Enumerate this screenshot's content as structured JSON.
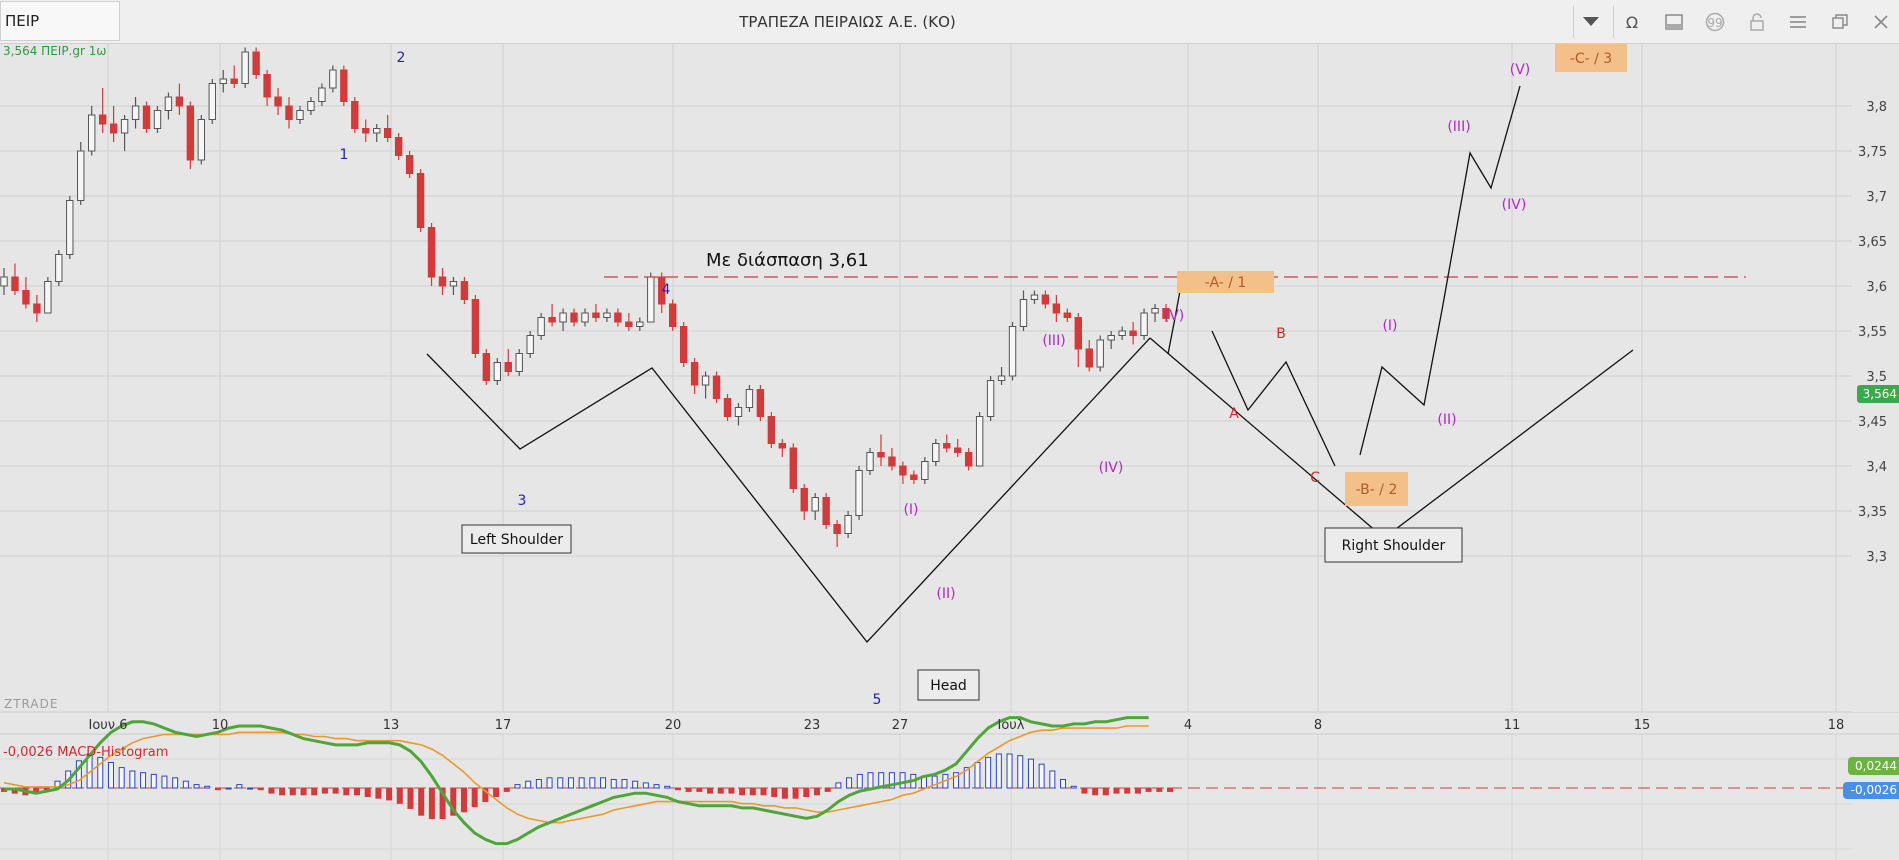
{
  "toolbar": {
    "symbol": "ΠΕΙΡ",
    "title": "ΤΡΑΠΕΖΑ ΠΕΙΡΑΙΩΣ Α.Ε. (ΚΟ)",
    "icons": [
      "chevron-down-icon",
      "omega-icon",
      "panel-icon",
      "quote-icon",
      "lock-icon",
      "menu-icon",
      "restore-icon",
      "close-icon"
    ]
  },
  "chart_label": "3,564 ΠΕΙΡ.gr 1ω",
  "watermark": "ZTRADE",
  "macd_label": "-0,0026 MACD-Histogram",
  "current_price_tag": "3,564",
  "macd_tag1": "0,0244",
  "macd_tag2": "-0,0026",
  "colors": {
    "up": "#f6f6f6",
    "down": "#d13b3b",
    "wave_blue": "#2323b5",
    "wave_purple": "#b02ac2",
    "wave_red": "#d12b2b",
    "box_orange": "#f4c08a",
    "macd_line": "#4fa53a",
    "signal_line": "#e89a2c"
  },
  "chart_data": {
    "type": "candlestick",
    "ylim": [
      3.27,
      3.86
    ],
    "yticks": [
      "3,3",
      "3,35",
      "3,4",
      "3,45",
      "3,5",
      "3,55",
      "3,6",
      "3,65",
      "3,7",
      "3,75",
      "3,8"
    ],
    "xticks": [
      "Ιουν 6",
      "10",
      "13",
      "17",
      "20",
      "23",
      "27",
      "Ιουλ",
      "4",
      "8",
      "11",
      "15",
      "18"
    ],
    "breakout_level": 3.61,
    "breakout_text": "Με διάσπαση 3,61",
    "candles": [
      [
        3.6,
        3.62,
        3.59,
        3.61
      ],
      [
        3.61,
        3.625,
        3.59,
        3.595
      ],
      [
        3.595,
        3.61,
        3.575,
        3.58
      ],
      [
        3.58,
        3.59,
        3.56,
        3.57
      ],
      [
        3.57,
        3.61,
        3.57,
        3.605
      ],
      [
        3.605,
        3.64,
        3.6,
        3.635
      ],
      [
        3.635,
        3.7,
        3.63,
        3.695
      ],
      [
        3.695,
        3.76,
        3.69,
        3.75
      ],
      [
        3.75,
        3.8,
        3.745,
        3.79
      ],
      [
        3.79,
        3.82,
        3.77,
        3.78
      ],
      [
        3.78,
        3.8,
        3.76,
        3.77
      ],
      [
        3.77,
        3.79,
        3.75,
        3.785
      ],
      [
        3.785,
        3.81,
        3.775,
        3.8
      ],
      [
        3.8,
        3.805,
        3.77,
        3.775
      ],
      [
        3.775,
        3.8,
        3.77,
        3.795
      ],
      [
        3.795,
        3.815,
        3.785,
        3.81
      ],
      [
        3.81,
        3.825,
        3.79,
        3.8
      ],
      [
        3.8,
        3.805,
        3.73,
        3.74
      ],
      [
        3.74,
        3.79,
        3.735,
        3.785
      ],
      [
        3.785,
        3.83,
        3.78,
        3.825
      ],
      [
        3.825,
        3.84,
        3.815,
        3.83
      ],
      [
        3.83,
        3.845,
        3.82,
        3.825
      ],
      [
        3.825,
        3.865,
        3.82,
        3.86
      ],
      [
        3.86,
        3.865,
        3.83,
        3.835
      ],
      [
        3.835,
        3.84,
        3.8,
        3.81
      ],
      [
        3.81,
        3.82,
        3.79,
        3.8
      ],
      [
        3.8,
        3.81,
        3.775,
        3.785
      ],
      [
        3.785,
        3.8,
        3.78,
        3.795
      ],
      [
        3.795,
        3.81,
        3.79,
        3.805
      ],
      [
        3.805,
        3.825,
        3.8,
        3.82
      ],
      [
        3.82,
        3.845,
        3.815,
        3.84
      ],
      [
        3.84,
        3.845,
        3.8,
        3.805
      ],
      [
        3.805,
        3.81,
        3.77,
        3.775
      ],
      [
        3.775,
        3.785,
        3.76,
        3.77
      ],
      [
        3.77,
        3.78,
        3.76,
        3.775
      ],
      [
        3.775,
        3.79,
        3.76,
        3.765
      ],
      [
        3.765,
        3.77,
        3.74,
        3.745
      ],
      [
        3.745,
        3.75,
        3.72,
        3.725
      ],
      [
        3.725,
        3.73,
        3.66,
        3.665
      ],
      [
        3.665,
        3.67,
        3.6,
        3.61
      ],
      [
        3.61,
        3.62,
        3.59,
        3.6
      ],
      [
        3.6,
        3.61,
        3.59,
        3.605
      ],
      [
        3.605,
        3.61,
        3.58,
        3.585
      ],
      [
        3.585,
        3.59,
        3.52,
        3.525
      ],
      [
        3.525,
        3.53,
        3.49,
        3.495
      ],
      [
        3.495,
        3.52,
        3.49,
        3.515
      ],
      [
        3.515,
        3.53,
        3.5,
        3.505
      ],
      [
        3.505,
        3.53,
        3.5,
        3.525
      ],
      [
        3.525,
        3.55,
        3.52,
        3.545
      ],
      [
        3.545,
        3.57,
        3.54,
        3.565
      ],
      [
        3.565,
        3.58,
        3.555,
        3.56
      ],
      [
        3.56,
        3.575,
        3.55,
        3.57
      ],
      [
        3.57,
        3.575,
        3.555,
        3.56
      ],
      [
        3.56,
        3.575,
        3.555,
        3.57
      ],
      [
        3.57,
        3.58,
        3.56,
        3.565
      ],
      [
        3.565,
        3.575,
        3.56,
        3.57
      ],
      [
        3.57,
        3.575,
        3.555,
        3.56
      ],
      [
        3.56,
        3.57,
        3.55,
        3.555
      ],
      [
        3.555,
        3.565,
        3.55,
        3.56
      ],
      [
        3.56,
        3.615,
        3.56,
        3.61
      ],
      [
        3.61,
        3.615,
        3.57,
        3.58
      ],
      [
        3.58,
        3.585,
        3.55,
        3.555
      ],
      [
        3.555,
        3.56,
        3.51,
        3.515
      ],
      [
        3.515,
        3.52,
        3.48,
        3.49
      ],
      [
        3.49,
        3.505,
        3.475,
        3.5
      ],
      [
        3.5,
        3.505,
        3.47,
        3.475
      ],
      [
        3.475,
        3.48,
        3.45,
        3.455
      ],
      [
        3.455,
        3.47,
        3.445,
        3.465
      ],
      [
        3.465,
        3.49,
        3.46,
        3.485
      ],
      [
        3.485,
        3.49,
        3.45,
        3.455
      ],
      [
        3.455,
        3.46,
        3.42,
        3.425
      ],
      [
        3.425,
        3.43,
        3.41,
        3.42
      ],
      [
        3.42,
        3.425,
        3.37,
        3.375
      ],
      [
        3.375,
        3.38,
        3.34,
        3.35
      ],
      [
        3.35,
        3.37,
        3.34,
        3.365
      ],
      [
        3.365,
        3.37,
        3.33,
        3.335
      ],
      [
        3.335,
        3.34,
        3.31,
        3.325
      ],
      [
        3.325,
        3.35,
        3.32,
        3.345
      ],
      [
        3.345,
        3.4,
        3.34,
        3.395
      ],
      [
        3.395,
        3.42,
        3.39,
        3.415
      ],
      [
        3.415,
        3.435,
        3.4,
        3.41
      ],
      [
        3.41,
        3.42,
        3.395,
        3.4
      ],
      [
        3.4,
        3.405,
        3.38,
        3.39
      ],
      [
        3.39,
        3.395,
        3.38,
        3.385
      ],
      [
        3.385,
        3.41,
        3.38,
        3.405
      ],
      [
        3.405,
        3.43,
        3.4,
        3.425
      ],
      [
        3.425,
        3.435,
        3.415,
        3.42
      ],
      [
        3.42,
        3.43,
        3.41,
        3.415
      ],
      [
        3.415,
        3.42,
        3.395,
        3.4
      ],
      [
        3.4,
        3.46,
        3.4,
        3.455
      ],
      [
        3.455,
        3.5,
        3.45,
        3.495
      ],
      [
        3.495,
        3.51,
        3.49,
        3.5
      ],
      [
        3.5,
        3.56,
        3.495,
        3.555
      ],
      [
        3.555,
        3.595,
        3.55,
        3.585
      ],
      [
        3.585,
        3.595,
        3.58,
        3.59
      ],
      [
        3.59,
        3.595,
        3.575,
        3.58
      ],
      [
        3.58,
        3.59,
        3.56,
        3.57
      ],
      [
        3.57,
        3.575,
        3.56,
        3.565
      ],
      [
        3.565,
        3.57,
        3.51,
        3.53
      ],
      [
        3.53,
        3.54,
        3.505,
        3.51
      ],
      [
        3.51,
        3.545,
        3.505,
        3.54
      ],
      [
        3.54,
        3.55,
        3.53,
        3.545
      ],
      [
        3.545,
        3.555,
        3.54,
        3.55
      ],
      [
        3.55,
        3.56,
        3.535,
        3.545
      ],
      [
        3.545,
        3.575,
        3.54,
        3.57
      ],
      [
        3.57,
        3.58,
        3.56,
        3.575
      ],
      [
        3.575,
        3.58,
        3.56,
        3.564
      ]
    ],
    "macd": {
      "label": "MACD-Histogram",
      "value": -0.0026,
      "histogram": [
        -0.002,
        -0.003,
        -0.004,
        -0.003,
        -0.001,
        0.004,
        0.01,
        0.016,
        0.02,
        0.018,
        0.015,
        0.012,
        0.01,
        0.009,
        0.008,
        0.007,
        0.006,
        0.004,
        0.002,
        0.001,
        -0.001,
        0.0,
        0.002,
        0.0,
        -0.001,
        -0.003,
        -0.004,
        -0.004,
        -0.004,
        -0.004,
        -0.003,
        -0.003,
        -0.004,
        -0.004,
        -0.005,
        -0.006,
        -0.007,
        -0.009,
        -0.012,
        -0.016,
        -0.018,
        -0.018,
        -0.016,
        -0.014,
        -0.011,
        -0.008,
        -0.005,
        -0.002,
        0.002,
        0.004,
        0.005,
        0.006,
        0.006,
        0.006,
        0.006,
        0.006,
        0.006,
        0.005,
        0.005,
        0.004,
        0.003,
        0.002,
        0.001,
        -0.001,
        -0.002,
        -0.002,
        -0.003,
        -0.003,
        -0.003,
        -0.004,
        -0.004,
        -0.004,
        -0.005,
        -0.006,
        -0.006,
        -0.005,
        -0.004,
        -0.002,
        0.003,
        0.006,
        0.008,
        0.009,
        0.009,
        0.009,
        0.009,
        0.008,
        0.007,
        0.007,
        0.008,
        0.009,
        0.012,
        0.015,
        0.018,
        0.02,
        0.02,
        0.019,
        0.017,
        0.014,
        0.01,
        0.005,
        0.001,
        -0.003,
        -0.004,
        -0.004,
        -0.003,
        -0.003,
        -0.003,
        -0.002,
        -0.002,
        -0.002
      ],
      "macd_line": [
        -0.01,
        -0.01,
        -0.011,
        -0.012,
        -0.011,
        -0.01,
        -0.006,
        0.0,
        0.006,
        0.012,
        0.017,
        0.02,
        0.022,
        0.022,
        0.021,
        0.019,
        0.017,
        0.016,
        0.015,
        0.016,
        0.017,
        0.019,
        0.02,
        0.02,
        0.02,
        0.019,
        0.018,
        0.016,
        0.014,
        0.013,
        0.012,
        0.011,
        0.011,
        0.011,
        0.012,
        0.012,
        0.012,
        0.011,
        0.008,
        0.003,
        -0.004,
        -0.012,
        -0.02,
        -0.026,
        -0.031,
        -0.034,
        -0.036,
        -0.036,
        -0.034,
        -0.031,
        -0.028,
        -0.026,
        -0.024,
        -0.022,
        -0.02,
        -0.018,
        -0.016,
        -0.014,
        -0.013,
        -0.012,
        -0.012,
        -0.013,
        -0.014,
        -0.016,
        -0.017,
        -0.018,
        -0.018,
        -0.018,
        -0.018,
        -0.019,
        -0.019,
        -0.02,
        -0.021,
        -0.022,
        -0.023,
        -0.024,
        -0.023,
        -0.02,
        -0.016,
        -0.013,
        -0.011,
        -0.01,
        -0.009,
        -0.008,
        -0.007,
        -0.006,
        -0.004,
        -0.003,
        -0.001,
        0.002,
        0.008,
        0.014,
        0.019,
        0.022,
        0.024,
        0.024,
        0.022,
        0.021,
        0.02,
        0.02,
        0.021,
        0.021,
        0.022,
        0.022,
        0.023,
        0.024,
        0.024,
        0.024
      ],
      "signal_line": [
        -0.007,
        -0.008,
        -0.009,
        -0.009,
        -0.009,
        -0.009,
        -0.008,
        -0.006,
        -0.002,
        0.002,
        0.006,
        0.009,
        0.012,
        0.014,
        0.015,
        0.016,
        0.016,
        0.016,
        0.016,
        0.016,
        0.016,
        0.016,
        0.017,
        0.017,
        0.017,
        0.017,
        0.017,
        0.016,
        0.016,
        0.015,
        0.015,
        0.014,
        0.014,
        0.013,
        0.013,
        0.013,
        0.013,
        0.013,
        0.012,
        0.011,
        0.009,
        0.006,
        0.002,
        -0.002,
        -0.007,
        -0.011,
        -0.015,
        -0.019,
        -0.022,
        -0.024,
        -0.025,
        -0.026,
        -0.026,
        -0.025,
        -0.024,
        -0.023,
        -0.022,
        -0.02,
        -0.019,
        -0.018,
        -0.017,
        -0.016,
        -0.016,
        -0.016,
        -0.016,
        -0.016,
        -0.016,
        -0.016,
        -0.016,
        -0.017,
        -0.017,
        -0.018,
        -0.018,
        -0.019,
        -0.019,
        -0.02,
        -0.021,
        -0.021,
        -0.02,
        -0.019,
        -0.018,
        -0.017,
        -0.016,
        -0.015,
        -0.013,
        -0.012,
        -0.01,
        -0.008,
        -0.006,
        -0.004,
        -0.001,
        0.003,
        0.007,
        0.01,
        0.013,
        0.015,
        0.017,
        0.018,
        0.018,
        0.019,
        0.019,
        0.019,
        0.019,
        0.019,
        0.019,
        0.02,
        0.02,
        0.02
      ]
    },
    "annotations": {
      "elliott_blue": [
        "1",
        "2",
        "3",
        "4",
        "5"
      ],
      "elliott_purple": [
        "(I)",
        "(II)",
        "(III)",
        "(IV)",
        "(V)",
        "(V)",
        "(I)",
        "(II)",
        "(III)",
        "(IV)",
        "(V)"
      ],
      "elliott_red": [
        "A",
        "B",
        "C"
      ],
      "boxes": [
        "-A- / 1",
        "-B- / 2",
        "-C- / 3"
      ],
      "labels": [
        "Left Shoulder",
        "Head",
        "Right Shoulder"
      ]
    }
  }
}
